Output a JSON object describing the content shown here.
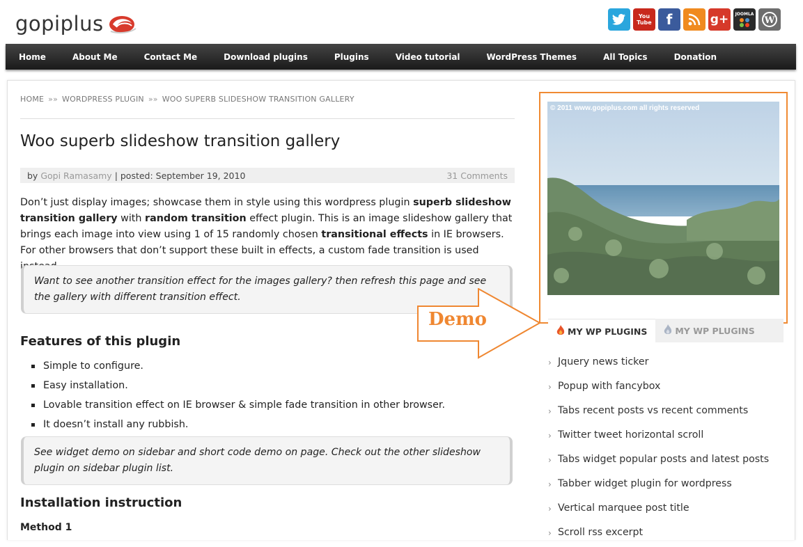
{
  "header": {
    "logo_text": "gopiplus",
    "social_icons": [
      {
        "name": "twitter-icon",
        "glyph": "t",
        "color": "#2aa6dd"
      },
      {
        "name": "youtube-icon",
        "glyph": "You Tube",
        "color": "#c8281c"
      },
      {
        "name": "facebook-icon",
        "glyph": "f",
        "color": "#3b5b9c"
      },
      {
        "name": "rss-icon",
        "glyph": ")",
        "color": "#f08a1f"
      },
      {
        "name": "google-plus-icon",
        "glyph": "g+",
        "color": "#d6392a"
      },
      {
        "name": "joomla-icon",
        "glyph": "JOOMLA",
        "color": "#2a2a2a"
      },
      {
        "name": "wordpress-icon",
        "glyph": "W",
        "color": "#6d6d6d"
      }
    ]
  },
  "nav": {
    "items": [
      "Home",
      "About Me",
      "Contact Me",
      "Download plugins",
      "Plugins",
      "Video tutorial",
      "WordPress Themes",
      "All Topics",
      "Donation"
    ]
  },
  "breadcrumb": {
    "home": "HOME",
    "category": "WORDPRESS PLUGIN",
    "current": "WOO SUPERB SLIDESHOW TRANSITION GALLERY",
    "separator": "»»"
  },
  "article": {
    "title": "Woo superb slideshow transition gallery",
    "by_label": "by",
    "author": "Gopi Ramasamy",
    "posted": "| posted: September 19, 2010",
    "comments": "31 Comments",
    "intro": {
      "p1": "Don’t just display images; showcase them in style using this wordpress plugin ",
      "b1": "superb slideshow transition gallery",
      "p2": " with ",
      "b2": "random transition",
      "p3": " effect plugin. This is an image slideshow gallery that brings each image into view using 1 of 15 randomly chosen ",
      "b3": "transitional effects",
      "p4": " in IE browsers. For other browsers that don’t support these built in effects, a custom fade transition is used instead."
    },
    "quote1": "Want to see another transition effect for the images gallery? then refresh this page and see the gallery with different transition effect.",
    "features_heading": "Features of this plugin",
    "features": [
      "Simple to configure.",
      "Easy installation.",
      "Lovable transition effect on IE browser & simple fade transition in other browser.",
      "It doesn’t install any rubbish."
    ],
    "quote2": "See widget demo on sidebar and short code demo on page. Check out the other slideshow plugin on sidebar plugin list.",
    "install_heading": "Installation instruction",
    "method1": "Method 1"
  },
  "sidebar": {
    "demo_caption": "© 2011 www.gopiplus.com all rights reserved",
    "demo_label": "Demo",
    "tabs": [
      "MY WP PLUGINS",
      "MY WP PLUGINS"
    ],
    "plugins": [
      "Jquery news ticker",
      "Popup with fancybox",
      "Tabs recent posts vs recent comments",
      "Twitter tweet horizontal scroll",
      "Tabs widget popular posts and latest posts",
      "Tabber widget plugin for wordpress",
      "Vertical marquee post title",
      "Scroll rss excerpt"
    ]
  },
  "colors": {
    "accent_orange": "#ef8731",
    "nav_bg": "#2a2a2a",
    "meta_link": "#999999"
  }
}
